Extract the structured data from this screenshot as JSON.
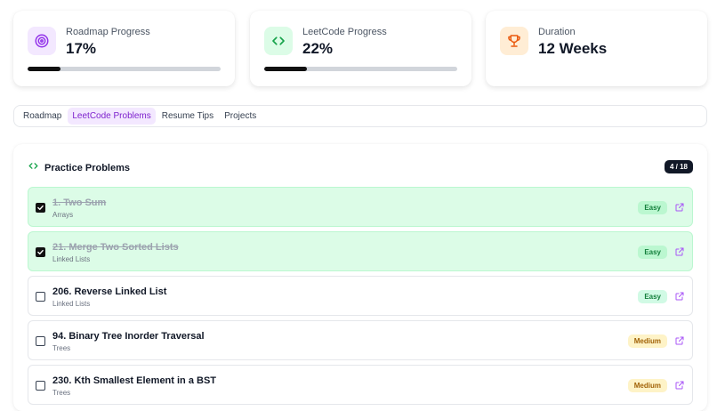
{
  "stats": {
    "roadmap": {
      "label": "Roadmap Progress",
      "value": "17%",
      "progress": 0.17,
      "icon": "target-icon",
      "bg": "#f3e8ff",
      "color": "#9333ea"
    },
    "leetcode": {
      "label": "LeetCode Progress",
      "value": "22%",
      "progress": 0.22,
      "icon": "code-icon",
      "bg": "#dcfce7",
      "color": "#16a34a"
    },
    "duration": {
      "label": "Duration",
      "value": "12 Weeks",
      "icon": "trophy-icon",
      "bg": "#ffedd5",
      "color": "#ea580c"
    }
  },
  "tabs": [
    {
      "label": "Roadmap",
      "active": false
    },
    {
      "label": "LeetCode Problems",
      "active": true
    },
    {
      "label": "Resume Tips",
      "active": false
    },
    {
      "label": "Projects",
      "active": false
    }
  ],
  "panel": {
    "title": "Practice Problems",
    "title_icon": "code-icon",
    "count": "4 / 18"
  },
  "problems": [
    {
      "title": "1. Two Sum",
      "topic": "Arrays",
      "difficulty": "Easy",
      "done": true
    },
    {
      "title": "21. Merge Two Sorted Lists",
      "topic": "Linked Lists",
      "difficulty": "Easy",
      "done": true
    },
    {
      "title": "206. Reverse Linked List",
      "topic": "Linked Lists",
      "difficulty": "Easy",
      "done": false
    },
    {
      "title": "94. Binary Tree Inorder Traversal",
      "topic": "Trees",
      "difficulty": "Medium",
      "done": false
    },
    {
      "title": "230. Kth Smallest Element in a BST",
      "topic": "Trees",
      "difficulty": "Medium",
      "done": false
    }
  ],
  "colors": {
    "accent": "#7e22ce",
    "easy": "#15803d",
    "medium": "#a16207",
    "link": "#a855f7"
  }
}
